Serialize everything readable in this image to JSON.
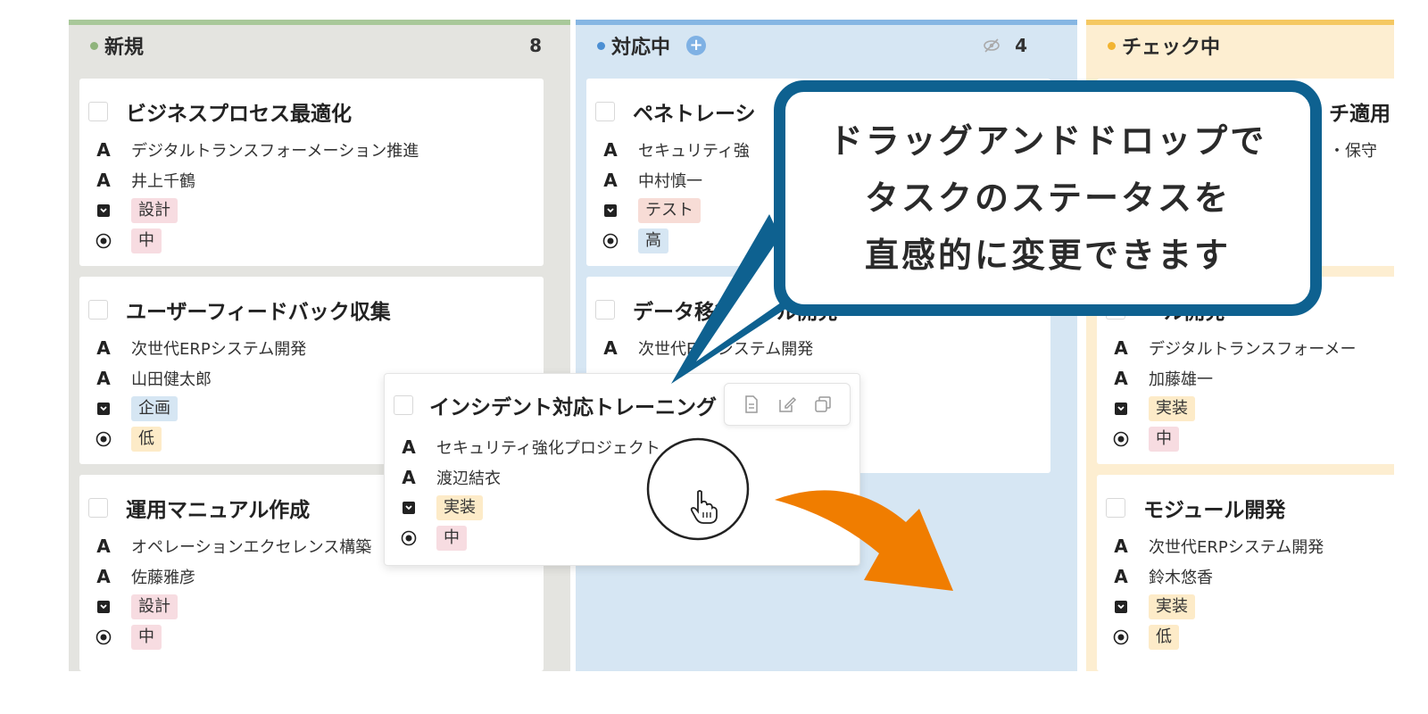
{
  "columns": [
    {
      "name": "新規",
      "count": "8",
      "cards": [
        {
          "title": "ビジネスプロセス最適化",
          "project": "デジタルトランスフォーメーション推進",
          "assignee": "井上千鶴",
          "phase": "設計",
          "priority": "中"
        },
        {
          "title": "ユーザーフィードバック収集",
          "project": "次世代ERPシステム開発",
          "assignee": "山田健太郎",
          "phase": "企画",
          "priority": "低"
        },
        {
          "title": "運用マニュアル作成",
          "project": "オペレーションエクセレンス構築",
          "assignee": "佐藤雅彦",
          "phase": "設計",
          "priority": "中"
        }
      ]
    },
    {
      "name": "対応中",
      "count": "4",
      "cards": [
        {
          "title": "ペネトレーシ",
          "project": "セキュリティ強",
          "assignee": "中村慎一",
          "phase": "テスト",
          "priority": "高"
        },
        {
          "title": "データ移行ツール開発",
          "project": "次世代ERPシステム開発"
        }
      ]
    },
    {
      "name": "チェック中",
      "cards": [
        {
          "title": "チ適用",
          "project": "・保守"
        },
        {
          "title": "ール開発",
          "project": "デジタルトランスフォーメー",
          "assignee": "加藤雄一",
          "phase": "実装",
          "priority": "中"
        },
        {
          "title": "モジュール開発",
          "project": "次世代ERPシステム開発",
          "assignee": "鈴木悠香",
          "phase": "実装",
          "priority": "低"
        }
      ]
    }
  ],
  "dragging_card": {
    "title": "インシデント対応トレーニング",
    "project": "セキュリティ強化プロジェクト",
    "assignee": "渡辺結衣",
    "phase": "実装",
    "priority": "中"
  },
  "callout": {
    "lines": [
      "ドラッグアンドドロップで",
      "タスクのステータスを",
      "直感的に変更できます"
    ]
  },
  "icons": {
    "property_text": "A",
    "phase_icon": "tag-icon",
    "priority_icon": "radio-target-icon",
    "cursor": "hand-pointer-icon"
  },
  "colors": {
    "callout_border": "#0e6190",
    "arrow": "#f07d00",
    "col_new": "#e4e4e0",
    "col_progress": "#d6e6f3",
    "col_check": "#fdeed1"
  }
}
